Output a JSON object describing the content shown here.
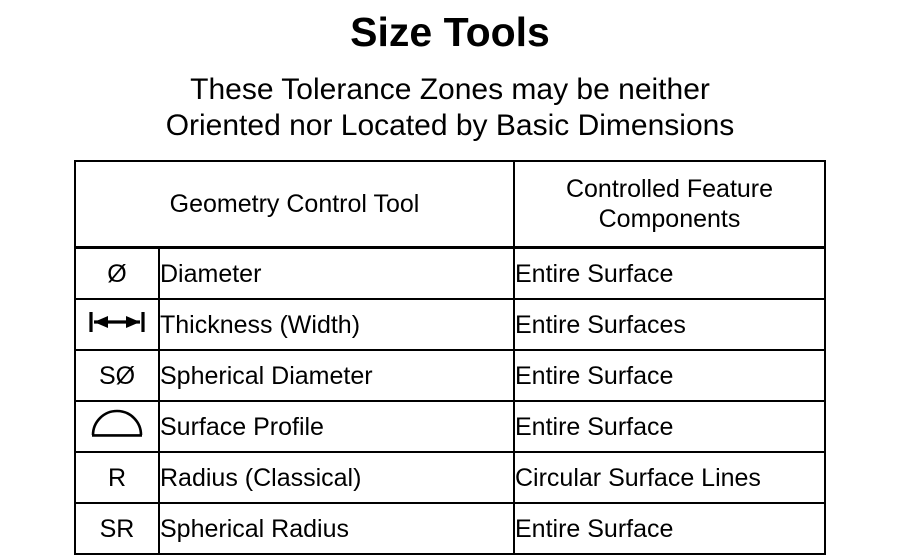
{
  "title": "Size Tools",
  "subtitle": {
    "line1": "These Tolerance Zones may be neither",
    "line2": "Oriented nor Located by Basic Dimensions"
  },
  "table": {
    "headers": {
      "left": "Geometry Control Tool",
      "right_line1": "Controlled Feature",
      "right_line2": "Components"
    },
    "rows": [
      {
        "symbol": "Ø",
        "symbol_name": "diameter-symbol",
        "name": "Diameter",
        "feature": "Entire Surface"
      },
      {
        "symbol": "",
        "symbol_name": "thickness-width-symbol",
        "name": "Thickness (Width)",
        "feature": "Entire Surfaces"
      },
      {
        "symbol": "SØ",
        "symbol_name": "spherical-diameter-symbol",
        "name": "Spherical Diameter",
        "feature": "Entire Surface"
      },
      {
        "symbol": "",
        "symbol_name": "surface-profile-symbol",
        "name": "Surface Profile",
        "feature": "Entire Surface"
      },
      {
        "symbol": "R",
        "symbol_name": "radius-symbol",
        "name": "Radius (Classical)",
        "feature": "Circular Surface Lines"
      },
      {
        "symbol": "SR",
        "symbol_name": "spherical-radius-symbol",
        "name": "Spherical Radius",
        "feature": "Entire Surface"
      }
    ]
  },
  "colors": {
    "ink": "#000000",
    "background": "#ffffff"
  }
}
